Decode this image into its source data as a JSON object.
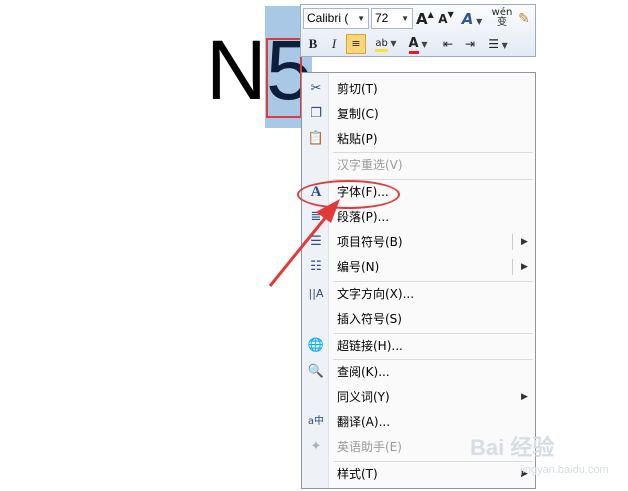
{
  "document": {
    "char_n": "N",
    "char_5": "5"
  },
  "mini_toolbar": {
    "font_name": "Calibri (",
    "font_size": "72",
    "grow_font": "A",
    "shrink_font": "A",
    "text_effects": "A",
    "phonetic": "wén 变",
    "bold": "B",
    "italic": "I",
    "font_color": "A"
  },
  "context_menu": {
    "items": [
      {
        "label": "剪切(T)",
        "icon": "scissors-icon"
      },
      {
        "label": "复制(C)",
        "icon": "copy-icon"
      },
      {
        "label": "粘贴(P)",
        "icon": "paste-icon"
      },
      {
        "label": "汉字重选(V)",
        "icon": "",
        "disabled": true
      },
      {
        "label": "字体(F)...",
        "icon": "font-icon"
      },
      {
        "label": "段落(P)...",
        "icon": "paragraph-icon"
      },
      {
        "label": "项目符号(B)",
        "icon": "bullets-icon",
        "submenu": true
      },
      {
        "label": "编号(N)",
        "icon": "numbering-icon",
        "submenu": true
      },
      {
        "label": "文字方向(X)...",
        "icon": "text-direction-icon"
      },
      {
        "label": "插入符号(S)",
        "icon": ""
      },
      {
        "label": "超链接(H)...",
        "icon": "hyperlink-icon"
      },
      {
        "label": "查阅(K)...",
        "icon": "lookup-icon"
      },
      {
        "label": "同义词(Y)",
        "icon": "",
        "submenu": true
      },
      {
        "label": "翻译(A)...",
        "icon": "translate-icon"
      },
      {
        "label": "英语助手(E)",
        "icon": "english-assistant-icon",
        "disabled": true
      },
      {
        "label": "样式(T)",
        "icon": "",
        "submenu": true
      }
    ]
  },
  "watermark": {
    "brand": "Bai 经验",
    "url": "jingyan.baidu.com"
  },
  "colors": {
    "selection": "#a9c8e6",
    "annotation_red": "#e23a3a",
    "highlight_yellow": "#f6e43c",
    "font_red": "#e02020"
  }
}
